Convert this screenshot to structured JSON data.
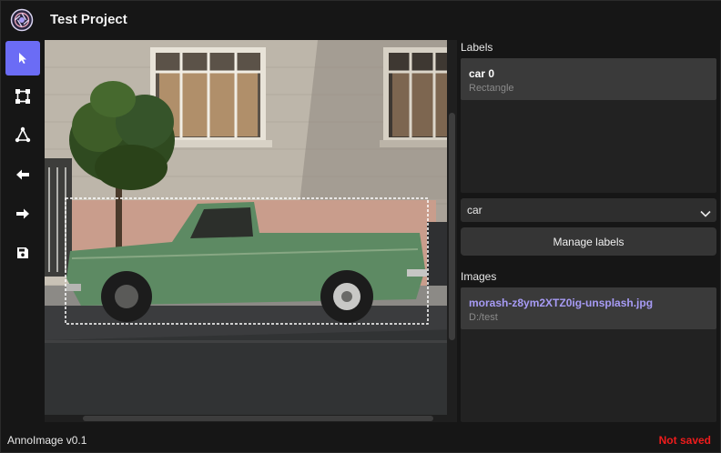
{
  "app": {
    "title": "Test Project",
    "logo_icon": "aperture-logo-icon"
  },
  "toolbar": {
    "tools": [
      {
        "name": "select-tool",
        "icon": "cursor-arrow-icon",
        "active": true
      },
      {
        "name": "rectangle-tool",
        "icon": "bounding-box-icon",
        "active": false
      },
      {
        "name": "polygon-tool",
        "icon": "polygon-icon",
        "active": false
      },
      {
        "name": "previous-image",
        "icon": "arrow-left-icon",
        "active": false
      },
      {
        "name": "next-image",
        "icon": "arrow-right-icon",
        "active": false
      },
      {
        "name": "save",
        "icon": "floppy-disk-icon",
        "active": false
      }
    ],
    "active_color": "#6b6cf5"
  },
  "canvas": {
    "image_description_hidden": false,
    "annotation": {
      "label": "car",
      "type": "Rectangle"
    }
  },
  "labels_panel": {
    "heading": "Labels",
    "items": [
      {
        "name": "car 0",
        "type": "Rectangle"
      }
    ]
  },
  "label_select": {
    "value": "car",
    "icon": "chevron-down-icon"
  },
  "manage_labels_button": {
    "label": "Manage labels"
  },
  "images_panel": {
    "heading": "Images",
    "items": [
      {
        "filename": "morash-z8ym2XTZ0ig-unsplash.jpg",
        "folder": "D:/test"
      }
    ],
    "accent": "#a79bf5"
  },
  "status_bar": {
    "version": "AnnoImage v0.1",
    "save_status": "Not saved",
    "save_status_color": "#f01c1c"
  }
}
